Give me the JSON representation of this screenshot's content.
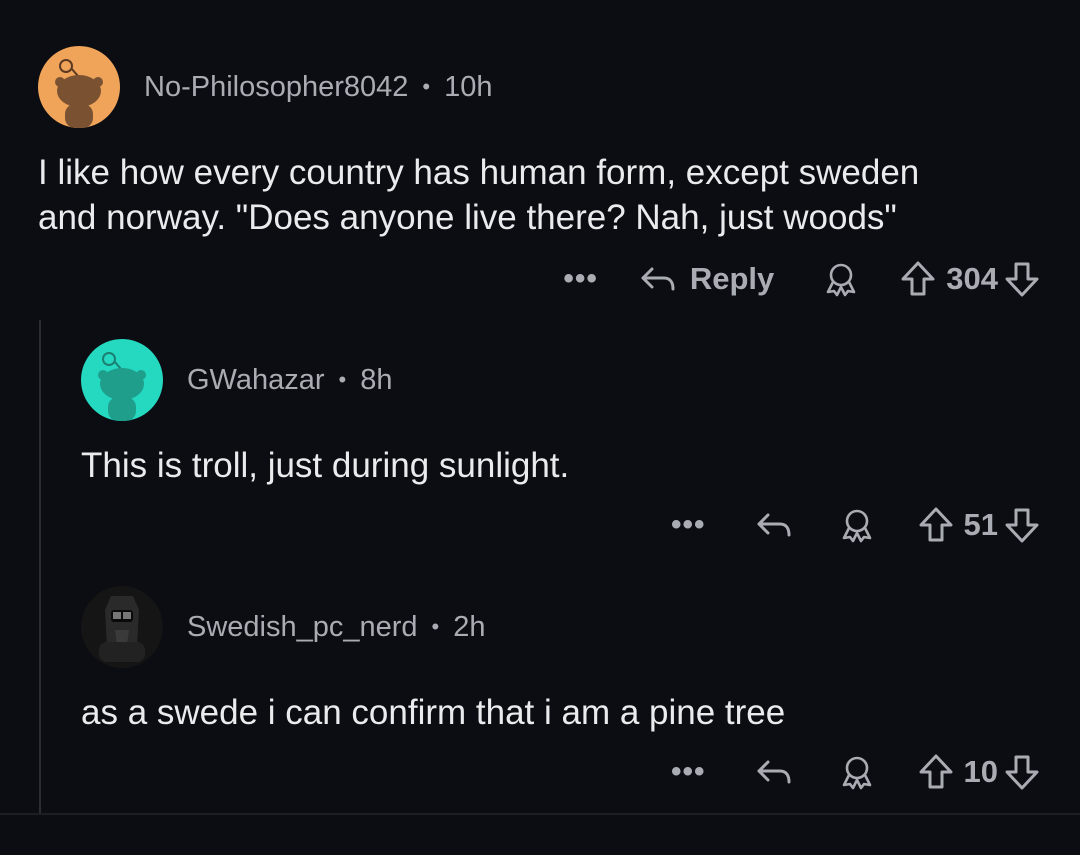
{
  "comments": [
    {
      "username": "No-Philosopher8042",
      "time": "10h",
      "text": "I like how every country has human form, except sweden\nand norway. \"Does anyone live there? Nah, just woods\"",
      "reply_label": "Reply",
      "score": "304",
      "avatar_color": "#f0a45a"
    },
    {
      "username": "GWahazar",
      "time": "8h",
      "text": "This is troll, just during sunlight.",
      "score": "51",
      "avatar_color": "#25d8c0"
    },
    {
      "username": "Swedish_pc_nerd",
      "time": "2h",
      "text": "as a swede i can confirm that i am a pine tree",
      "score": "10",
      "avatar_color": "#111111"
    }
  ],
  "separator": "•",
  "more_label": "•••",
  "icons": [
    "more-icon",
    "reply-icon",
    "award-icon",
    "upvote-icon",
    "downvote-icon",
    "snoo-avatar-icon"
  ]
}
